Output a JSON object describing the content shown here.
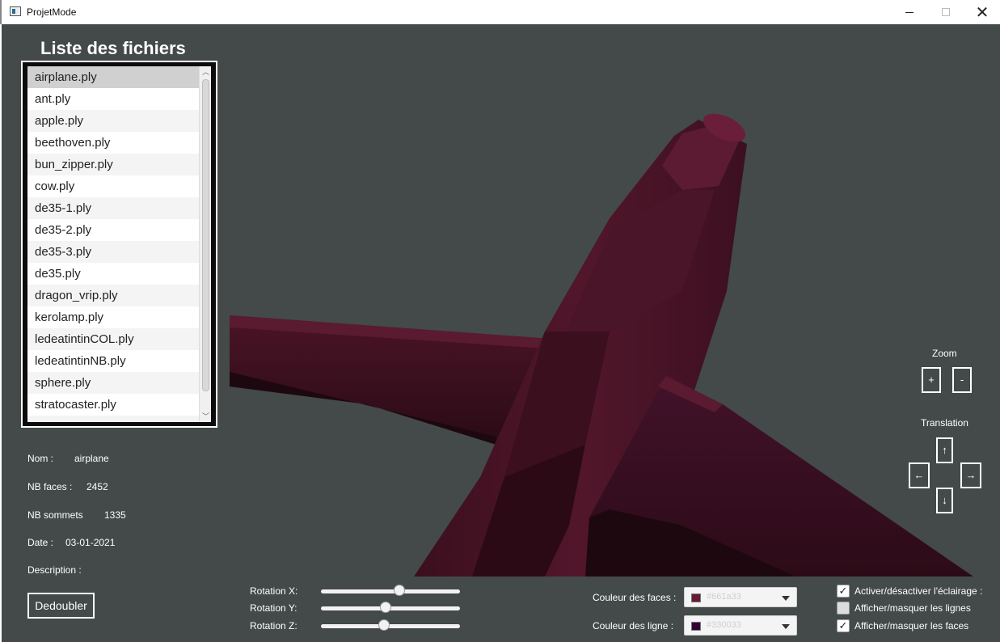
{
  "window": {
    "title": "ProjetMode"
  },
  "file_list": {
    "title": "Liste des fichiers",
    "items": [
      "airplane.ply",
      "ant.ply",
      "apple.ply",
      "beethoven.ply",
      "bun_zipper.ply",
      "cow.ply",
      "de35-1.ply",
      "de35-2.ply",
      "de35-3.ply",
      "de35.ply",
      "dragon_vrip.ply",
      "kerolamp.ply",
      "ledeatintinCOL.ply",
      "ledeatintinNB.ply",
      "sphere.ply",
      "stratocaster.ply"
    ],
    "selected": "airplane.ply"
  },
  "info": {
    "name_label": "Nom :",
    "name_value": "airplane",
    "faces_label": "NB faces :",
    "faces_value": "2452",
    "vertices_label": "NB sommets",
    "vertices_value": "1335",
    "date_label": "Date :",
    "date_value": "03-01-2021",
    "description_label": "Description :"
  },
  "dedoubler_label": "Dedoubler",
  "zoom": {
    "label": "Zoom",
    "plus": "+",
    "minus": "-"
  },
  "translation": {
    "label": "Translation",
    "up": "↑",
    "left": "←",
    "right": "→",
    "down": "↓"
  },
  "rotation": {
    "x_label": "Rotation X:",
    "x_level": 0.57,
    "y_label": "Rotation Y:",
    "y_level": 0.46,
    "z_label": "Rotation Z:",
    "z_level": 0.45
  },
  "colors": {
    "face_label": "Couleur des faces :",
    "face_value": "#661a33",
    "line_label": "Couleur des ligne :",
    "line_value": "#330033"
  },
  "checkboxes": {
    "lighting_label": "Activer/désactiver l'éclairage :",
    "lighting_checked": true,
    "lines_label": "Afficher/masquer les lignes",
    "lines_checked": false,
    "faces_label": "Afficher/masquer les faces",
    "faces_checked": true
  },
  "theme": {
    "background": "#434a49",
    "model_color": "#661a33"
  }
}
